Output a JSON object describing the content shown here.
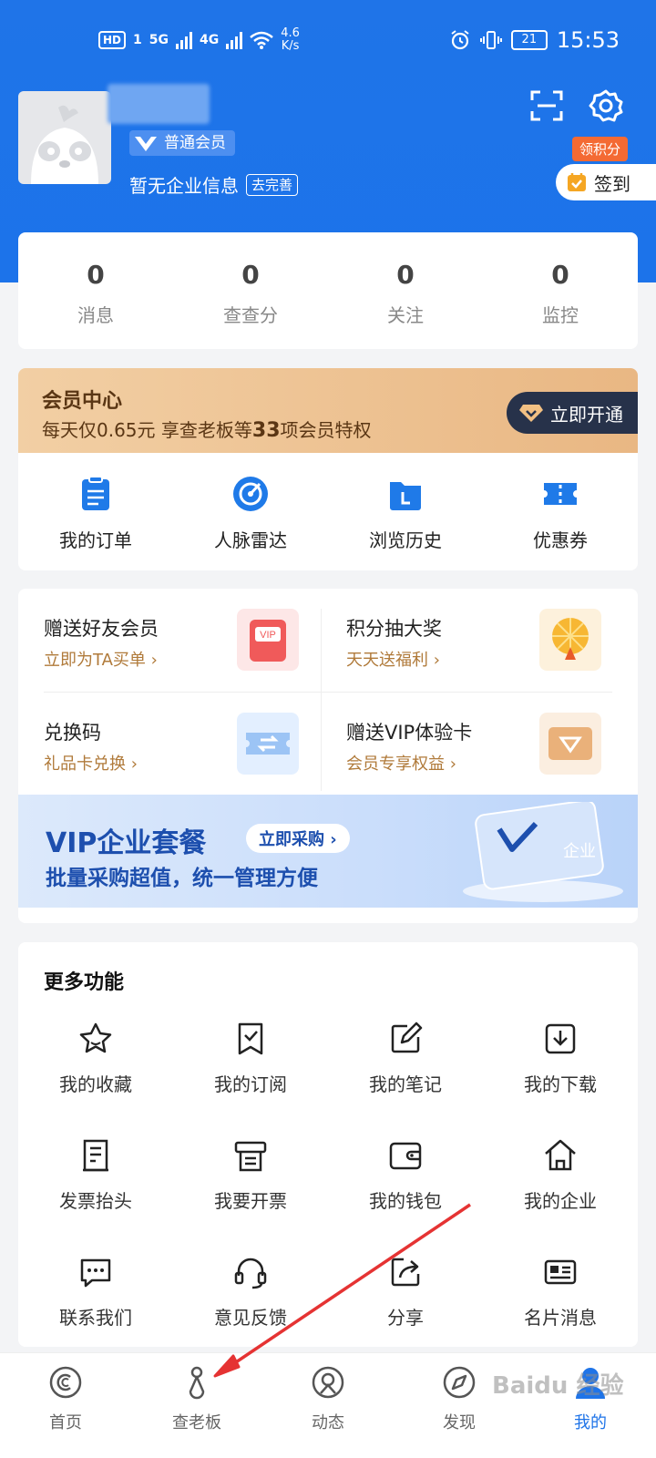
{
  "status_bar": {
    "hd": "HD",
    "sim": "1",
    "net1": "5G",
    "net2": "4G",
    "speed_value": "4.6",
    "speed_unit": "K/s",
    "battery": "21",
    "time": "15:53"
  },
  "profile": {
    "member_level": "普通会员",
    "company_info": "暂无企业信息",
    "complete_label": "去完善",
    "points_tag": "领积分",
    "checkin_label": "签到"
  },
  "stats": [
    {
      "value": "0",
      "label": "消息"
    },
    {
      "value": "0",
      "label": "查查分"
    },
    {
      "value": "0",
      "label": "关注"
    },
    {
      "value": "0",
      "label": "监控"
    }
  ],
  "vip": {
    "title": "会员中心",
    "subtitle_prefix": "每天仅0.65元  享查老板等",
    "subtitle_count": "33",
    "subtitle_suffix": "项会员特权",
    "open_label": "立即开通"
  },
  "quick_actions": [
    {
      "label": "我的订单",
      "icon": "order-icon"
    },
    {
      "label": "人脉雷达",
      "icon": "radar-icon"
    },
    {
      "label": "浏览历史",
      "icon": "history-icon"
    },
    {
      "label": "优惠券",
      "icon": "coupon-icon"
    }
  ],
  "gifts": [
    {
      "title": "赠送好友会员",
      "sub": "立即为TA买单 ›",
      "icon": "vip-gift-icon"
    },
    {
      "title": "积分抽大奖",
      "sub": "天天送福利 ›",
      "icon": "lottery-wheel-icon"
    },
    {
      "title": "兑换码",
      "sub": "礼品卡兑换 ›",
      "icon": "redeem-ticket-icon"
    },
    {
      "title": "赠送VIP体验卡",
      "sub": "会员专享权益 ›",
      "icon": "vip-card-icon"
    }
  ],
  "vip_package": {
    "title": "VIP企业套餐",
    "buy_label": "立即采购 ›",
    "subtitle": "批量采购超值，统一管理方便",
    "card_text": "企业"
  },
  "more": {
    "title": "更多功能",
    "items": [
      {
        "label": "我的收藏",
        "icon": "star-icon"
      },
      {
        "label": "我的订阅",
        "icon": "subscribe-icon"
      },
      {
        "label": "我的笔记",
        "icon": "note-icon"
      },
      {
        "label": "我的下载",
        "icon": "download-icon"
      },
      {
        "label": "发票抬头",
        "icon": "invoice-title-icon"
      },
      {
        "label": "我要开票",
        "icon": "invoice-icon"
      },
      {
        "label": "我的钱包",
        "icon": "wallet-icon"
      },
      {
        "label": "我的企业",
        "icon": "company-icon"
      },
      {
        "label": "联系我们",
        "icon": "chat-icon"
      },
      {
        "label": "意见反馈",
        "icon": "headset-icon"
      },
      {
        "label": "分享",
        "icon": "share-icon"
      },
      {
        "label": "名片消息",
        "icon": "card-icon"
      }
    ]
  },
  "tabs": [
    {
      "label": "首页",
      "icon": "home-icon"
    },
    {
      "label": "查老板",
      "icon": "boss-icon"
    },
    {
      "label": "动态",
      "icon": "feed-icon"
    },
    {
      "label": "发现",
      "icon": "compass-icon"
    },
    {
      "label": "我的",
      "icon": "profile-icon"
    }
  ],
  "watermark": "Baidu 经验",
  "colors": {
    "primary": "#1f74e8",
    "vip_gold": "#e9b783",
    "vip_dark": "#27324a",
    "accent_orange": "#f46a33",
    "annotation_red": "#e53333"
  }
}
